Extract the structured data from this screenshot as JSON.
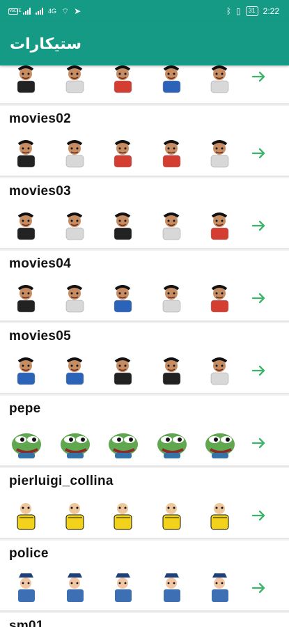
{
  "status_bar": {
    "left_badges": [
      "VoLTE",
      "4G"
    ],
    "battery": "31",
    "time": "2:22"
  },
  "app_bar": {
    "title": "ستيكارات"
  },
  "accent_color": "#159a85",
  "arrow_color": "#3db36a",
  "packs": [
    {
      "name": "",
      "stickers": [
        "woman-face-sticker",
        "cartoon-man-sticker",
        "man-portrait-sticker",
        "red-face-sticker",
        "man-in-suit-sticker"
      ]
    },
    {
      "name": "movies02",
      "stickers": [
        "woman-face-sticker",
        "man-in-red-shirt-sticker",
        "man-in-black-sticker",
        "laughing-man-sticker",
        "smiling-man-sticker"
      ]
    },
    {
      "name": "movies03",
      "stickers": [
        "green-shirt-man-sticker",
        "man-in-suit-sticker",
        "man-in-red-sticker",
        "man-with-glasses-sticker",
        "man-with-hat-sticker"
      ]
    },
    {
      "name": "movies04",
      "stickers": [
        "man-in-red-sticker",
        "man-in-blue-sticker",
        "red-faced-man-sticker",
        "man-in-blue-sticker",
        "man-in-white-sticker"
      ]
    },
    {
      "name": "movies05",
      "stickers": [
        "dark-suit-man-sticker",
        "bald-man-sticker",
        "man-in-red-cape-sticker",
        "man-in-red-cape-sticker",
        "bearded-man-sticker"
      ]
    },
    {
      "name": "pepe",
      "stickers": [
        "pepe-frog-sticker",
        "pepe-crying-sticker",
        "pepe-party-sticker",
        "pepe-smile-sticker",
        "pepe-crying-sticker"
      ]
    },
    {
      "name": "pierluigi_collina",
      "stickers": [
        "referee-sitting-sticker",
        "referee-arms-sticker",
        "referee-card-sticker",
        "referee-megaphone-sticker",
        "referee-thumbs-down-sticker"
      ]
    },
    {
      "name": "police",
      "stickers": [
        "police-sitting-sticker",
        "police-man-sticker",
        "police-angel-sticker",
        "police-at-desk-sticker",
        "police-officer-sticker"
      ]
    },
    {
      "name": "sm01",
      "stickers": []
    }
  ]
}
